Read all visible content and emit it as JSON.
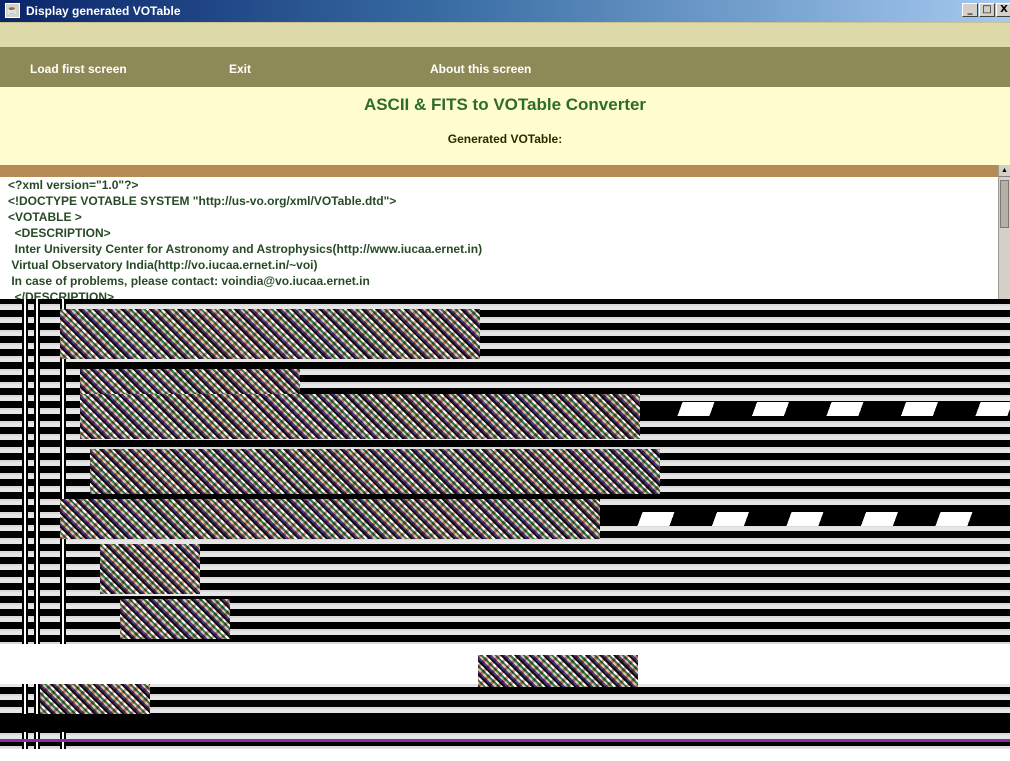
{
  "window": {
    "title": "Display generated VOTable",
    "icon": "java-cup-icon",
    "controls": {
      "minimize": "_",
      "maximize": "□",
      "close": "X"
    }
  },
  "menu": {
    "items": [
      {
        "label": "Load first screen"
      },
      {
        "label": "Exit"
      },
      {
        "label": "About this screen"
      }
    ]
  },
  "header": {
    "heading": "ASCII & FITS to VOTable Converter",
    "subheading": "Generated VOTable:"
  },
  "xml": {
    "lines": [
      "<?xml version=\"1.0\"?>",
      "<!DOCTYPE VOTABLE SYSTEM \"http://us-vo.org/xml/VOTable.dtd\">",
      "<VOTABLE >",
      "  <DESCRIPTION>",
      "  Inter University Center for Astronomy and Astrophysics(http://www.iucaa.ernet.in)",
      " Virtual Observatory India(http://vo.iucaa.ernet.in/~voi)",
      " In case of problems, please contact: voindia@vo.iucaa.ernet.in",
      "  </DESCRIPTION>"
    ]
  },
  "colors": {
    "menubar": "#8e8a57",
    "header_bg": "#fffccd",
    "heading": "#2e6b2e",
    "xml_text": "#274a27"
  }
}
